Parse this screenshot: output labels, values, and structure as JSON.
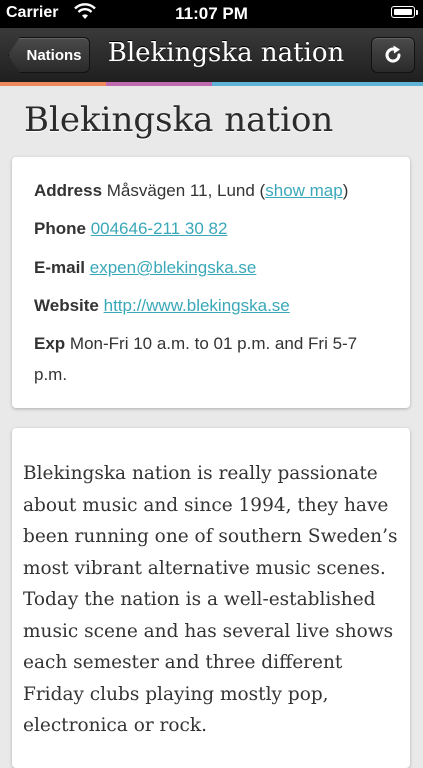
{
  "status_bar": {
    "carrier": "Carrier",
    "time": "11:07 PM"
  },
  "nav": {
    "back_label": "Nations",
    "title": "Blekingska nation",
    "refresh_icon": "refresh-icon"
  },
  "accent_colors": [
    "#f08a5d",
    "#c06bb0",
    "#5fb3d6",
    "#5fb3d6"
  ],
  "page_title": "Blekingska nation",
  "info": {
    "address_label": "Address",
    "address_value": "Måsvägen 11, Lund (",
    "address_link": "show map",
    "address_tail": ")",
    "phone_label": "Phone",
    "phone_value": "004646-211 30 82",
    "email_label": "E-mail",
    "email_value": "expen@blekingska.se",
    "website_label": "Website",
    "website_value": "http://www.blekingska.se",
    "exp_label": "Exp",
    "exp_value": "Mon-Fri 10 a.m. to 01 p.m. and Fri 5-7",
    "exp_value_line2": "p.m."
  },
  "description": "Blekingska nation is really passionate about music and since 1994, they have been running one of southern Sweden’s most vibrant alternative music scenes. Today the nation is a well-established music scene and has several live shows each semester and three different Friday clubs playing mostly pop, electronica or rock.",
  "link_color": "#3aa8b8"
}
